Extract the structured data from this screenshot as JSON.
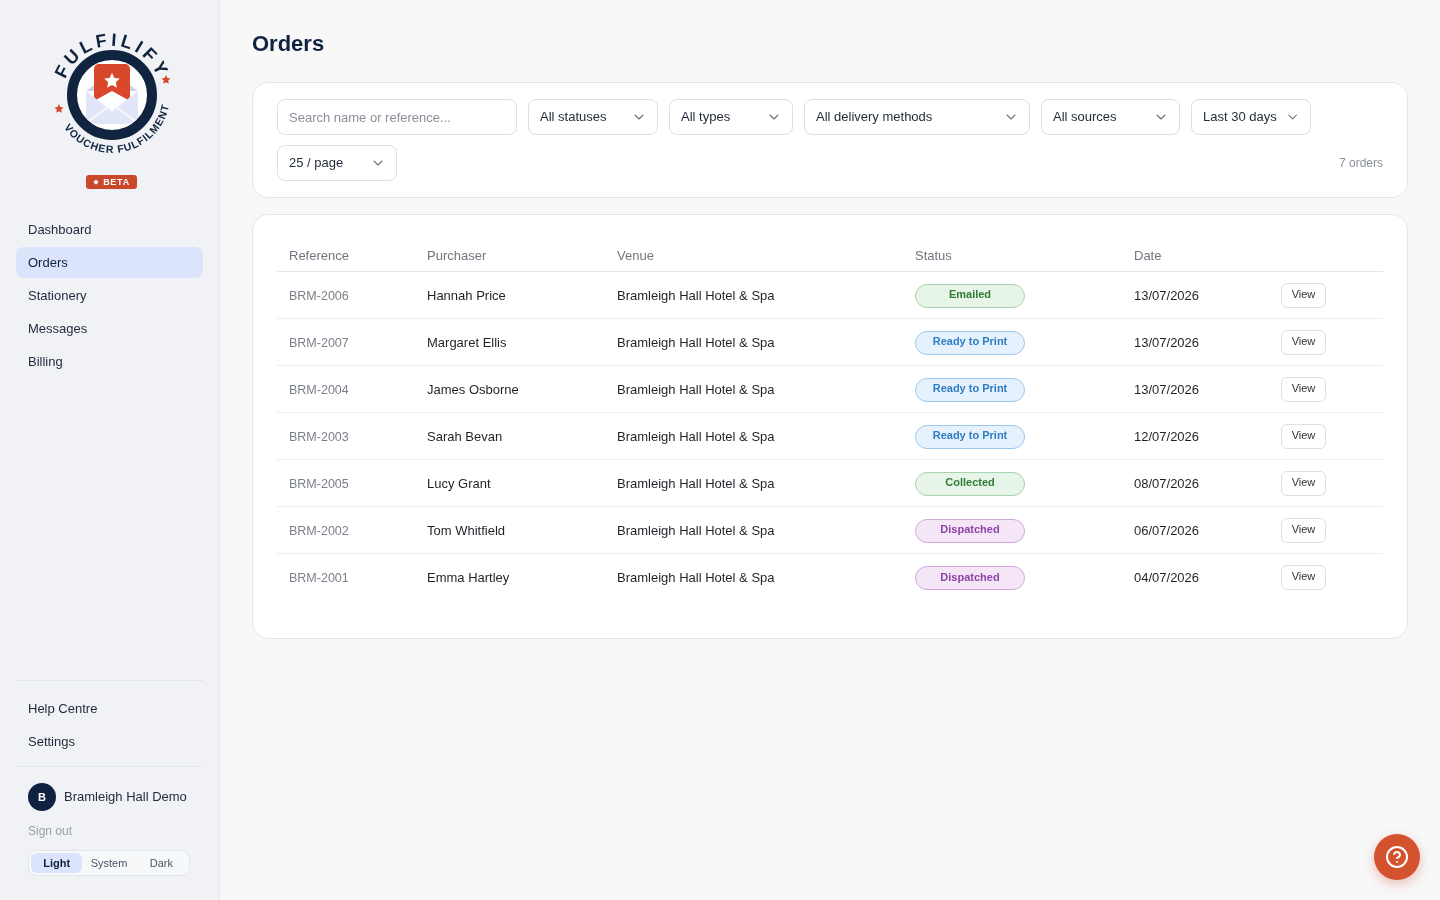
{
  "sidebar": {
    "logo": {
      "wordmark": "FULFILIFY",
      "tagline": "VOUCHER FULFILMENT",
      "badge": "BETA"
    },
    "nav": [
      {
        "label": "Dashboard",
        "selected": false
      },
      {
        "label": "Orders",
        "selected": true
      },
      {
        "label": "Stationery",
        "selected": false
      },
      {
        "label": "Messages",
        "selected": false
      },
      {
        "label": "Billing",
        "selected": false
      }
    ],
    "footer_links": [
      "Help Centre",
      "Settings"
    ],
    "account": {
      "initial": "B",
      "name": "Bramleigh Hall Demo",
      "sign_out": "Sign out"
    },
    "theme_options": [
      {
        "label": "Light",
        "selected": true
      },
      {
        "label": "System",
        "selected": false
      },
      {
        "label": "Dark",
        "selected": false
      }
    ]
  },
  "page_title": "Orders",
  "filters": {
    "search": {
      "placeholder": "Search name or reference..."
    },
    "selects": [
      "All statuses",
      "All types",
      "All delivery methods",
      "All sources",
      "Last 30 days"
    ],
    "page_size": "25 / page",
    "count": "7 orders"
  },
  "table": {
    "columns": [
      "Reference",
      "Purchaser",
      "Venue",
      "Status",
      "Date"
    ],
    "rows": [
      {
        "reference": "BRM-2006",
        "purchaser": "Hannah Price",
        "venue": "Bramleigh Hall Hotel & Spa",
        "status": {
          "label": "Emailed",
          "kind": "emailed"
        },
        "date": "13/07/2026",
        "action": "View"
      },
      {
        "reference": "BRM-2007",
        "purchaser": "Margaret Ellis",
        "venue": "Bramleigh Hall Hotel & Spa",
        "status": {
          "label": "Ready to Print",
          "kind": "ready_to_print"
        },
        "date": "13/07/2026",
        "action": "View"
      },
      {
        "reference": "BRM-2004",
        "purchaser": "James Osborne",
        "venue": "Bramleigh Hall Hotel & Spa",
        "status": {
          "label": "Ready to Print",
          "kind": "ready_to_print"
        },
        "date": "13/07/2026",
        "action": "View"
      },
      {
        "reference": "BRM-2003",
        "purchaser": "Sarah Bevan",
        "venue": "Bramleigh Hall Hotel & Spa",
        "status": {
          "label": "Ready to Print",
          "kind": "ready_to_print"
        },
        "date": "12/07/2026",
        "action": "View"
      },
      {
        "reference": "BRM-2005",
        "purchaser": "Lucy Grant",
        "venue": "Bramleigh Hall Hotel & Spa",
        "status": {
          "label": "Collected",
          "kind": "collected"
        },
        "date": "08/07/2026",
        "action": "View"
      },
      {
        "reference": "BRM-2002",
        "purchaser": "Tom Whitfield",
        "venue": "Bramleigh Hall Hotel & Spa",
        "status": {
          "label": "Dispatched",
          "kind": "dispatched"
        },
        "date": "06/07/2026",
        "action": "View"
      },
      {
        "reference": "BRM-2001",
        "purchaser": "Emma Hartley",
        "venue": "Bramleigh Hall Hotel & Spa",
        "status": {
          "label": "Dispatched",
          "kind": "dispatched"
        },
        "date": "04/07/2026",
        "action": "View"
      }
    ]
  }
}
